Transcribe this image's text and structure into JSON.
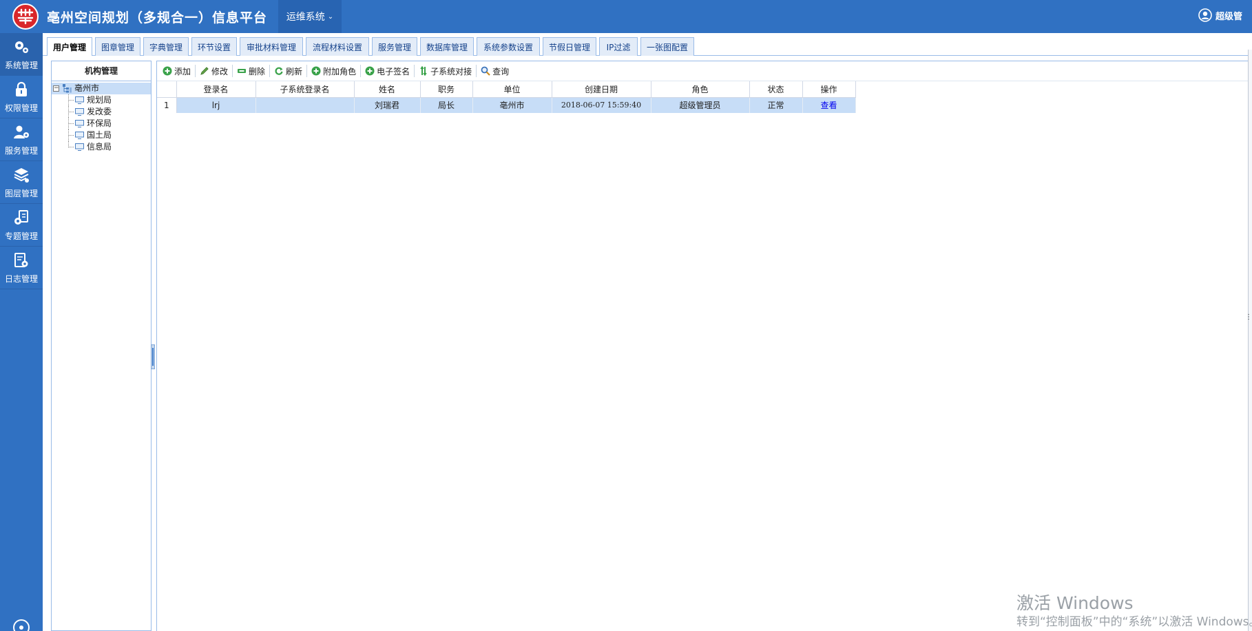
{
  "header": {
    "title": "亳州空间规划（多规合一）信息平台",
    "system_menu": "运维系统",
    "user": "超级管"
  },
  "sidebar": {
    "items": [
      {
        "label": "系统管理",
        "icon": "gears-icon"
      },
      {
        "label": "权限管理",
        "icon": "lock-icon"
      },
      {
        "label": "服务管理",
        "icon": "user-gear-icon"
      },
      {
        "label": "图层管理",
        "icon": "layers-icon"
      },
      {
        "label": "专题管理",
        "icon": "topic-icon"
      },
      {
        "label": "日志管理",
        "icon": "log-icon"
      }
    ]
  },
  "tabs": [
    {
      "label": "用户管理"
    },
    {
      "label": "图章管理"
    },
    {
      "label": "字典管理"
    },
    {
      "label": "环节设置"
    },
    {
      "label": "审批材料管理"
    },
    {
      "label": "流程材料设置"
    },
    {
      "label": "服务管理"
    },
    {
      "label": "数据库管理"
    },
    {
      "label": "系统参数设置"
    },
    {
      "label": "节假日管理"
    },
    {
      "label": "IP过滤"
    },
    {
      "label": "一张图配置"
    }
  ],
  "org_panel": {
    "title": "机构管理",
    "root": "亳州市",
    "children": [
      "规划局",
      "发改委",
      "环保局",
      "国土局",
      "信息局"
    ]
  },
  "toolbar": {
    "add": "添加",
    "edit": "修改",
    "delete": "删除",
    "refresh": "刷新",
    "attach_role": "附加角色",
    "esign": "电子签名",
    "subsystem": "子系统对接",
    "query": "查询"
  },
  "grid": {
    "columns": [
      "登录名",
      "子系统登录名",
      "姓名",
      "职务",
      "单位",
      "创建日期",
      "角色",
      "状态",
      "操作"
    ],
    "rows": [
      {
        "num": "1",
        "login": "lrj",
        "sub_login": "",
        "name": "刘瑞君",
        "position": "局长",
        "unit": "亳州市",
        "created": "2018-06-07 15:59:40",
        "role": "超级管理员",
        "status": "正常",
        "action": "查看"
      }
    ]
  },
  "watermark": {
    "line1": "激活 Windows",
    "line2": "转到“控制面板”中的“系统”以激活 Windows。"
  },
  "colors": {
    "header_blue": "#3071c2",
    "selected_row": "#c7ddf7",
    "tab_border": "#99bbe8"
  }
}
